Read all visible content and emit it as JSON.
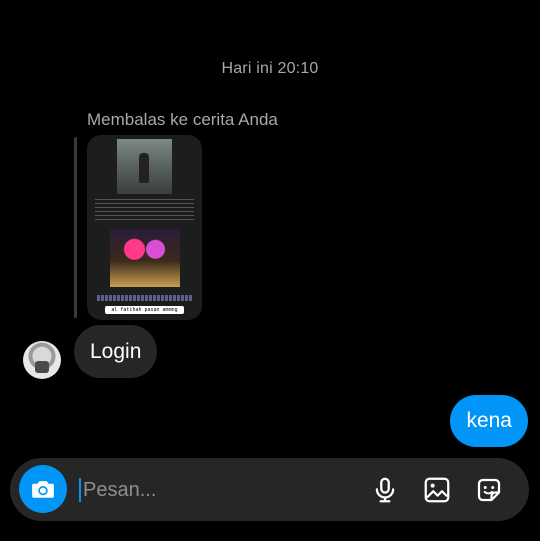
{
  "conversation": {
    "timestamp": "Hari ini 20:10",
    "reply_context": "Membalas ke cerita Anda",
    "story_caption": "al fatihah pasan ammng",
    "messages": [
      {
        "from": "other",
        "text": "Login"
      },
      {
        "from": "me",
        "text": "kena"
      }
    ]
  },
  "composer": {
    "placeholder": "Pesan...",
    "icons": [
      "camera-icon",
      "microphone-icon",
      "gallery-icon",
      "sticker-icon"
    ]
  },
  "colors": {
    "background": "#000000",
    "incoming_bubble": "#262626",
    "outgoing_bubble": "#0095f6",
    "accent": "#0095f6"
  }
}
